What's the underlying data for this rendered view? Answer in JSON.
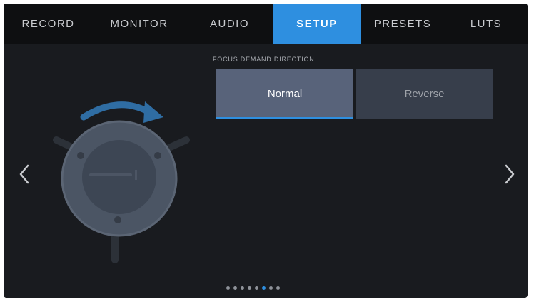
{
  "tabs": [
    {
      "label": "RECORD",
      "active": false
    },
    {
      "label": "MONITOR",
      "active": false
    },
    {
      "label": "AUDIO",
      "active": false
    },
    {
      "label": "SETUP",
      "active": true
    },
    {
      "label": "PRESETS",
      "active": false
    },
    {
      "label": "LUTS",
      "active": false
    }
  ],
  "focus_demand": {
    "label": "FOCUS DEMAND DIRECTION",
    "options": [
      "Normal",
      "Reverse"
    ],
    "selected": "Normal"
  },
  "navigation": {
    "left_icon": "chevron-left-icon",
    "right_icon": "chevron-right-icon"
  },
  "illustration_icon": "focus-demand-icon",
  "pager": {
    "total": 8,
    "current": 6
  },
  "colors": {
    "accent": "#2e8fe0",
    "background": "#191b1f",
    "tabbar": "#0e0f11",
    "selected_option": "#58637a",
    "unselected_option": "#373e4b"
  }
}
